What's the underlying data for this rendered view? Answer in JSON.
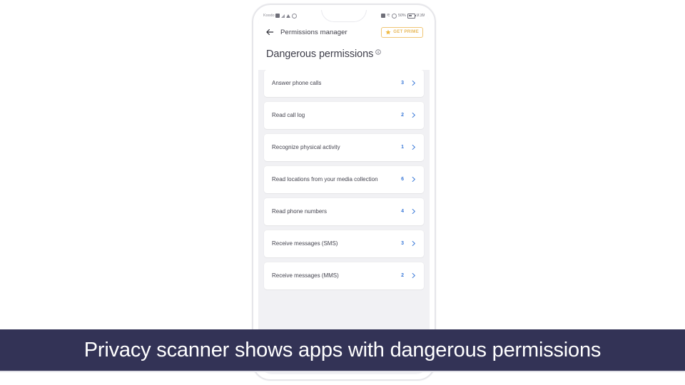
{
  "status_bar": {
    "carrier": "Koodo",
    "battery_percent": "50%",
    "time": "9:39",
    "left_icons": [
      "sim-icon",
      "signal-icon",
      "wifi-icon",
      "mute-icon"
    ],
    "right_icons": [
      "vibrate-icon",
      "bluetooth-icon",
      "alarm-icon",
      "battery-icon"
    ]
  },
  "app_bar": {
    "back_label": "back-arrow",
    "title": "Permissions manager",
    "prime_button": "GET PRIME"
  },
  "page": {
    "title": "Dangerous permissions",
    "info_tooltip": "info"
  },
  "permissions": [
    {
      "name": "Answer phone calls",
      "count": "3"
    },
    {
      "name": "Read call log",
      "count": "2"
    },
    {
      "name": "Recognize physical activity",
      "count": "1"
    },
    {
      "name": "Read locations from your media collection",
      "count": "6"
    },
    {
      "name": "Read phone numbers",
      "count": "4"
    },
    {
      "name": "Receive messages (SMS)",
      "count": "3"
    },
    {
      "name": "Receive messages (MMS)",
      "count": "2"
    }
  ],
  "caption": {
    "text": "Privacy scanner shows apps with dangerous permissions"
  },
  "colors": {
    "accent_blue": "#3a79d8",
    "banner_navy": "#333356",
    "prime_gold": "#e7b85b",
    "page_bg": "#f1f1f4"
  }
}
